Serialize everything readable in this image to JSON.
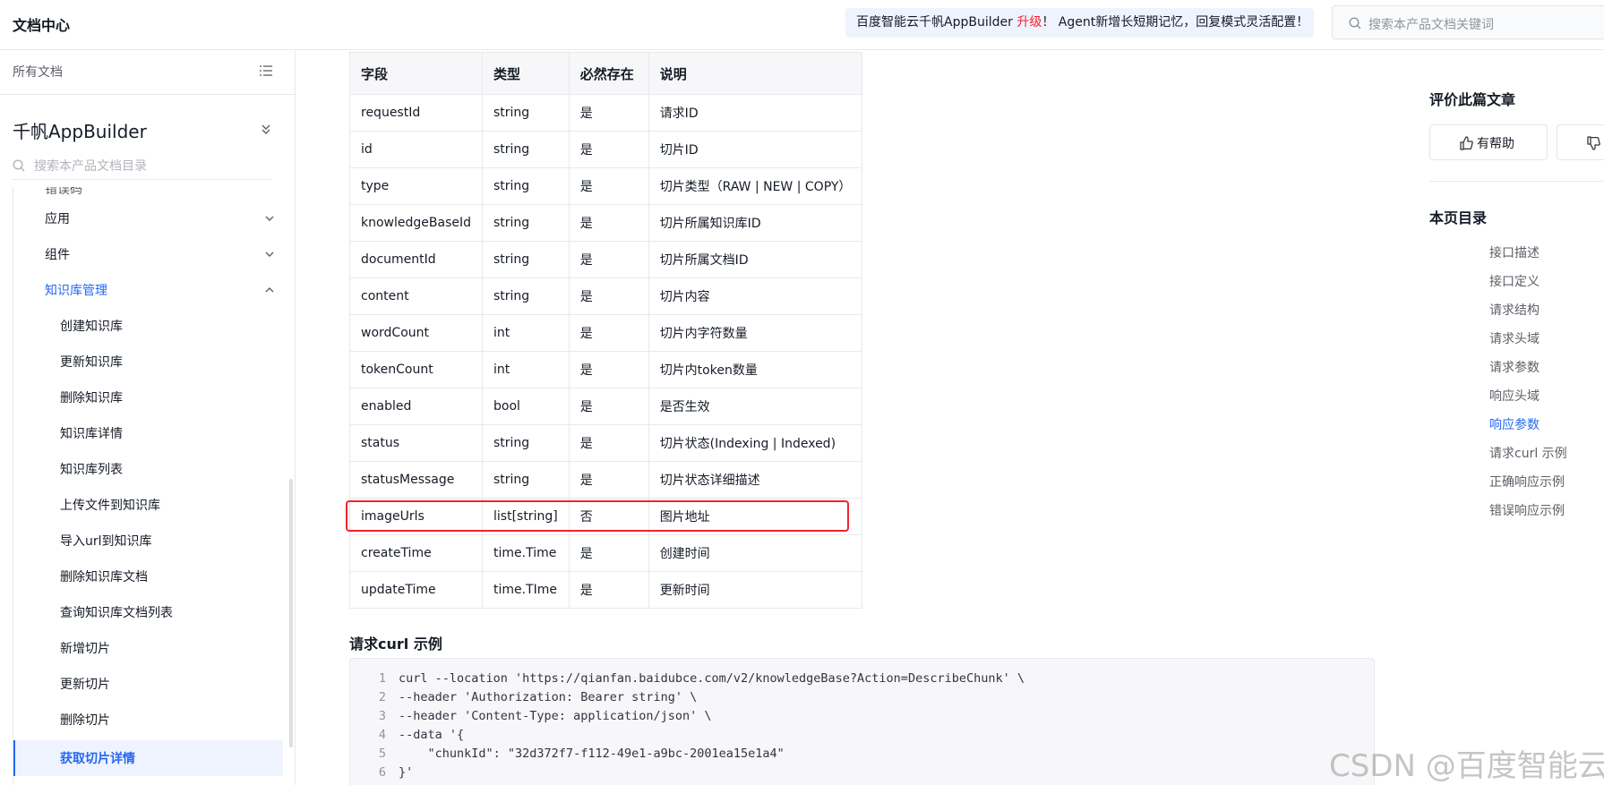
{
  "header": {
    "title": "文档中心",
    "banner_prefix": "百度智能云千帆AppBuilder ",
    "banner_highlight": "升级",
    "banner_suffix": "！ Agent新增长短期记忆，回复模式灵活配置！",
    "search_placeholder": "搜索本产品文档关键词"
  },
  "sidebar": {
    "all_docs": "所有文档",
    "product": "千帆AppBuilder",
    "search_placeholder": "搜索本产品文档目录",
    "partial_item": "错误码",
    "groups": [
      {
        "label": "应用"
      },
      {
        "label": "组件"
      },
      {
        "label": "知识库管理"
      }
    ],
    "items": [
      {
        "label": "创建知识库"
      },
      {
        "label": "更新知识库"
      },
      {
        "label": "删除知识库"
      },
      {
        "label": "知识库详情"
      },
      {
        "label": "知识库列表"
      },
      {
        "label": "上传文件到知识库"
      },
      {
        "label": "导入url到知识库"
      },
      {
        "label": "删除知识库文档"
      },
      {
        "label": "查询知识库文档列表"
      },
      {
        "label": "新增切片"
      },
      {
        "label": "更新切片"
      },
      {
        "label": "删除切片"
      },
      {
        "label": "获取切片详情"
      }
    ]
  },
  "table": {
    "headers": [
      "字段",
      "类型",
      "必然存在",
      "说明"
    ],
    "rows": [
      [
        "requestId",
        "string",
        "是",
        "请求ID"
      ],
      [
        "id",
        "string",
        "是",
        "切片ID"
      ],
      [
        "type",
        "string",
        "是",
        "切片类型（RAW | NEW | COPY）"
      ],
      [
        "knowledgeBaseId",
        "string",
        "是",
        "切片所属知识库ID"
      ],
      [
        "documentId",
        "string",
        "是",
        "切片所属文档ID"
      ],
      [
        "content",
        "string",
        "是",
        "切片内容"
      ],
      [
        "wordCount",
        "int",
        "是",
        "切片内字符数量"
      ],
      [
        "tokenCount",
        "int",
        "是",
        "切片内token数量"
      ],
      [
        "enabled",
        "bool",
        "是",
        "是否生效"
      ],
      [
        "status",
        "string",
        "是",
        "切片状态(Indexing | Indexed)"
      ],
      [
        "statusMessage",
        "string",
        "是",
        "切片状态详细描述"
      ],
      [
        "imageUrls",
        "list[string]",
        "否",
        "图片地址"
      ],
      [
        "createTime",
        "time.Time",
        "是",
        "创建时间"
      ],
      [
        "updateTime",
        "time.TIme",
        "是",
        "更新时间"
      ]
    ]
  },
  "curl": {
    "title": "请求curl 示例",
    "lines": [
      {
        "n": "1",
        "text": "curl --location 'https://qianfan.baidubce.com/v2/knowledgeBase?Action=DescribeChunk' \\"
      },
      {
        "n": "2",
        "text": "--header 'Authorization: Bearer string' \\"
      },
      {
        "n": "3",
        "text": "--header 'Content-Type: application/json' \\"
      },
      {
        "n": "4",
        "text": "--data '{"
      },
      {
        "n": "5",
        "text": "    \"chunkId\": \"32d372f7-f112-49e1-a9bc-2001ea15e1a4\""
      },
      {
        "n": "6",
        "text": "}'"
      }
    ]
  },
  "right": {
    "rate_title": "评价此篇文章",
    "helpful": "有帮助",
    "toc_title": "本页目录",
    "toc": [
      {
        "label": "接口描述"
      },
      {
        "label": "接口定义"
      },
      {
        "label": "请求结构"
      },
      {
        "label": "请求头域"
      },
      {
        "label": "请求参数"
      },
      {
        "label": "响应头域"
      },
      {
        "label": "响应参数"
      },
      {
        "label": "请求curl 示例"
      },
      {
        "label": "正确响应示例"
      },
      {
        "label": "错误响应示例"
      }
    ]
  },
  "watermark": "CSDN @百度智能云",
  "colors": {
    "accent": "#2468f2",
    "highlight": "#f5222d"
  }
}
